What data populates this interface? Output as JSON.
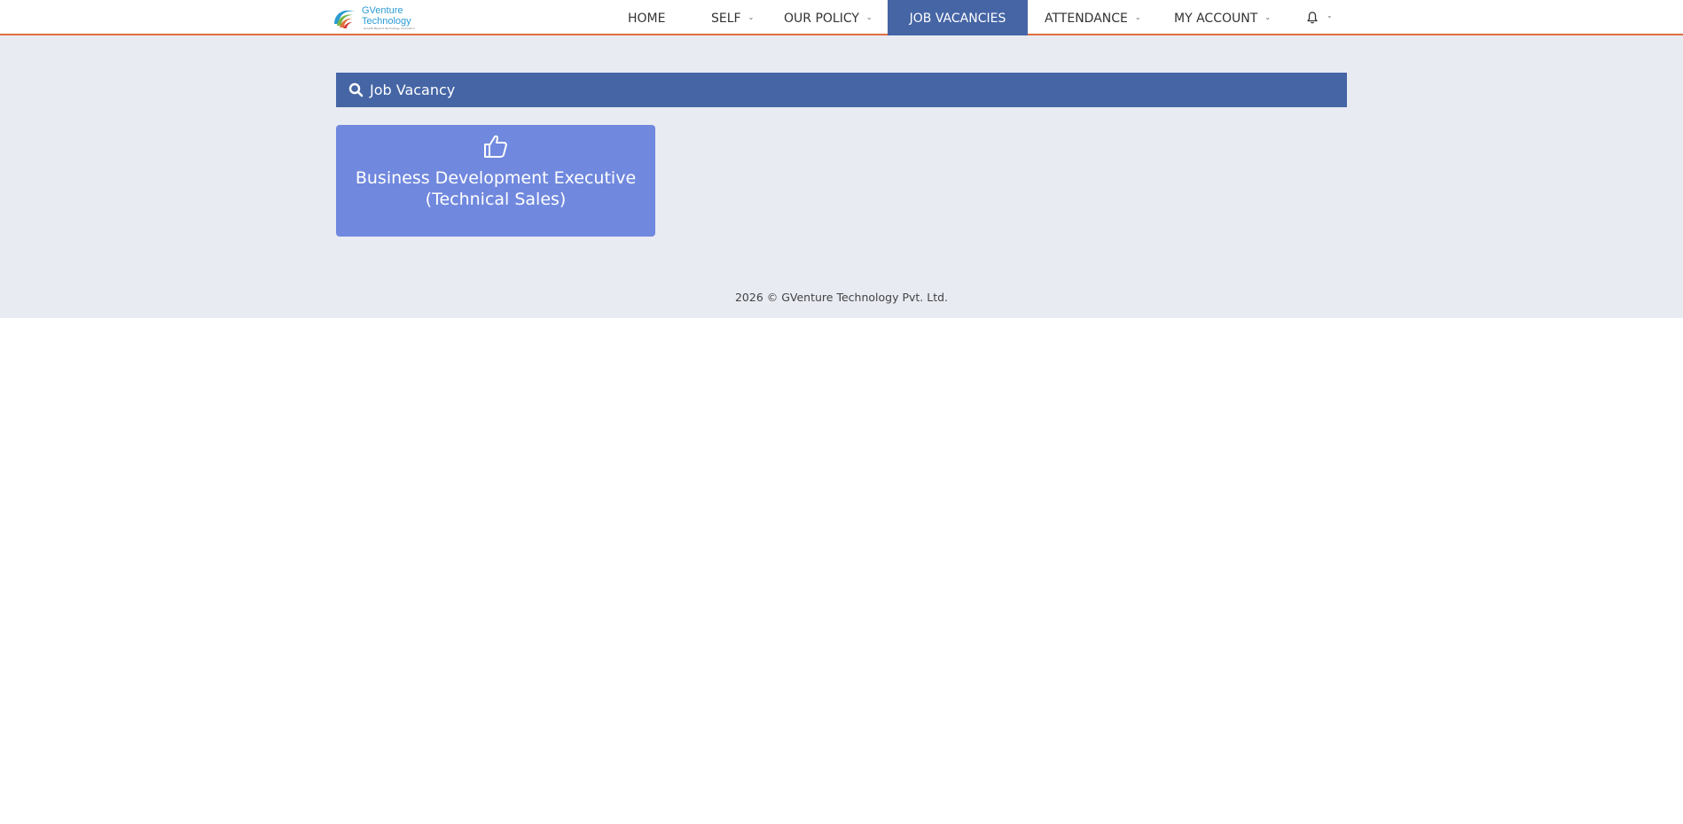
{
  "header": {
    "logo_line1": "GVenture",
    "logo_line2": "Technology",
    "logo_tagline": "Growth Beyond Technology Innovation",
    "accent_color": "#e0703e"
  },
  "nav": {
    "items": [
      {
        "label": "HOME",
        "has_dropdown": false
      },
      {
        "label": "SELF",
        "has_dropdown": true
      },
      {
        "label": "OUR POLICY",
        "has_dropdown": true
      },
      {
        "label": "JOB VACANCIES",
        "has_dropdown": false,
        "active": true
      },
      {
        "label": "ATTENDANCE",
        "has_dropdown": true
      },
      {
        "label": "MY ACCOUNT",
        "has_dropdown": true
      }
    ],
    "notification_icon": "bell-icon",
    "active_color": "#4565a5"
  },
  "panel": {
    "icon": "search-icon",
    "title": "Job Vacancy",
    "color": "#4565a5"
  },
  "jobs": [
    {
      "icon": "thumbs-up-icon",
      "title": "Business Development Executive (Technical Sales)",
      "color": "#7088de"
    }
  ],
  "footer": {
    "text": "2026 © GVenture Technology Pvt. Ltd."
  }
}
